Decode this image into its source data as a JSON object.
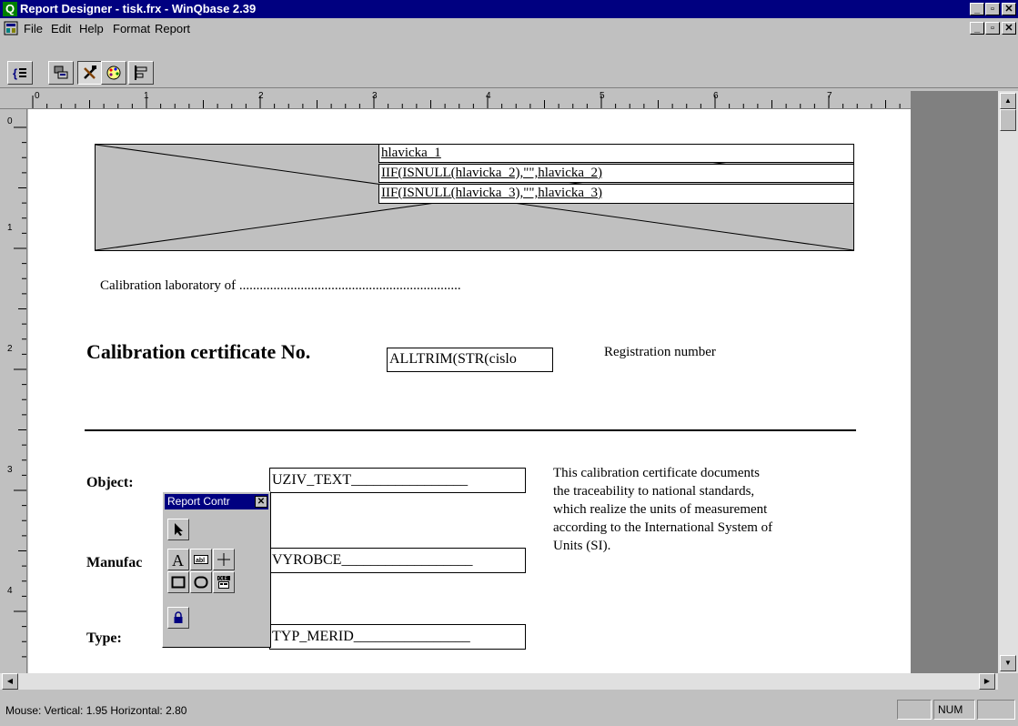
{
  "window": {
    "title": "Report Designer - tisk.frx - WinQbase 2.39",
    "app_icon_glyph": "Q"
  },
  "menu": {
    "items": [
      "File",
      "Edit",
      "Help",
      "Format",
      "Report"
    ]
  },
  "toolbar": {
    "buttons": [
      "data-environment-icon",
      "layout-icon",
      "tools-icon",
      "color-palette-icon",
      "align-icon"
    ],
    "pressed": "tools-icon"
  },
  "ruler": {
    "h_labels": [
      "0",
      "1",
      "2",
      "3",
      "4",
      "5",
      "6",
      "7"
    ],
    "v_labels": [
      "0",
      "1",
      "2",
      "3",
      "4"
    ]
  },
  "report": {
    "header_fields": [
      "hlavicka_1",
      "IIF(ISNULL(hlavicka_2),\"\",hlavicka_2)",
      "IIF(ISNULL(hlavicka_3),\"\",hlavicka_3)"
    ],
    "lab_line": "Calibration laboratory of .................................................................",
    "cert_title": "Calibration certificate No.",
    "cert_field": "ALLTRIM(STR(cislo",
    "registration": "Registration number",
    "object_label": "Object:",
    "object_field": "UZIV_TEXT",
    "manufacturer_label": "Manufac",
    "manufacturer_field": "VYROBCE",
    "type_label": "Type:",
    "type_field": "TYP_MERID",
    "paragraph": [
      "This calibration certificate documents",
      "the traceability to national standards,",
      "which realize the units of measurement",
      "according to the International System of",
      "Units (SI)."
    ]
  },
  "palette": {
    "title": "Report Contr",
    "tools": [
      "pointer-icon",
      "label-icon",
      "field-icon",
      "line-icon",
      "rectangle-icon",
      "rounded-rectangle-icon",
      "ole-picture-icon",
      "lock-icon"
    ]
  },
  "status": {
    "text": "Mouse:  Vertical: 1.95   Horizontal: 2.80",
    "num": "NUM"
  },
  "colors": {
    "titlebar": "#000080",
    "face": "#c0c0c0",
    "page": "#ffffff"
  }
}
